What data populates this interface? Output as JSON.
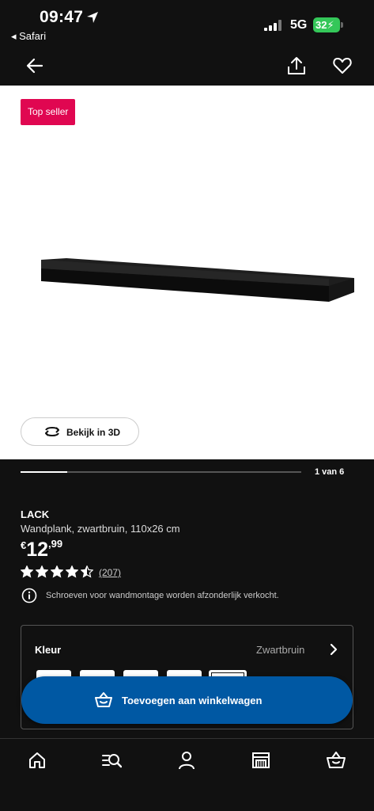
{
  "status_bar": {
    "time": "09:47",
    "back_app": "◂ Safari",
    "network": "5G",
    "battery": "32"
  },
  "header": {
    "back_icon": "arrow-left-icon",
    "share_icon": "share-icon",
    "favorite_icon": "heart-icon"
  },
  "media": {
    "badge": "Top seller",
    "view_3d_label": "Bekijk in 3D",
    "image_position": 1,
    "image_total": 6,
    "page_counter": "1 van 6"
  },
  "product": {
    "name": "LACK",
    "description": "Wandplank, zwartbruin, 110x26 cm",
    "price_currency": "€",
    "price_integer": "12",
    "price_decimal": ",99",
    "rating": 4.5,
    "rating_max": 5,
    "reviews": "(207)",
    "notice": "Schroeven voor wandmontage worden afzonderlijk verkocht."
  },
  "color_selector": {
    "label": "Kleur",
    "value": "Zwartbruin",
    "selected_index": 4
  },
  "cta": {
    "label": "Toevoegen aan winkelwagen",
    "icon": "basket-icon"
  },
  "bottom_nav": [
    {
      "name": "home",
      "icon": "home-icon"
    },
    {
      "name": "search",
      "icon": "search-icon"
    },
    {
      "name": "account",
      "icon": "person-icon"
    },
    {
      "name": "store",
      "icon": "store-icon"
    },
    {
      "name": "cart",
      "icon": "basket-icon"
    }
  ],
  "colors": {
    "badge": "#e00751",
    "cta": "#0058a3",
    "battery": "#34c759",
    "background": "#111111"
  }
}
